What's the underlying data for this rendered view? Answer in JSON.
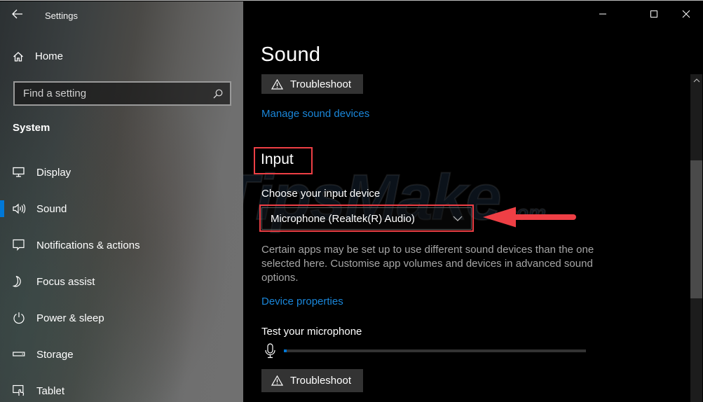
{
  "window": {
    "title": "Settings",
    "controls": {
      "minimize": "minimize-icon",
      "maximize": "maximize-icon",
      "close": "close-icon"
    }
  },
  "sidebar": {
    "back_icon": "back-arrow-icon",
    "home_label": "Home",
    "search_placeholder": "Find a setting",
    "section_title": "System",
    "items": [
      {
        "label": "Display",
        "icon": "monitor-icon",
        "active": false
      },
      {
        "label": "Sound",
        "icon": "speaker-icon",
        "active": true
      },
      {
        "label": "Notifications & actions",
        "icon": "notification-icon",
        "active": false
      },
      {
        "label": "Focus assist",
        "icon": "moon-icon",
        "active": false
      },
      {
        "label": "Power & sleep",
        "icon": "power-icon",
        "active": false
      },
      {
        "label": "Storage",
        "icon": "storage-icon",
        "active": false
      },
      {
        "label": "Tablet",
        "icon": "tablet-icon",
        "active": false
      }
    ],
    "accent_color": "#0078d7"
  },
  "main": {
    "page_title": "Sound",
    "output_troubleshoot_label": "Troubleshoot",
    "manage_devices_link": "Manage sound devices",
    "input_heading": "Input",
    "choose_device_label": "Choose your input device",
    "selected_input_device": "Microphone (Realtek(R) Audio)",
    "description": "Certain apps may be set up to use different sound devices than the one selected here. Customise app volumes and devices in advanced sound options.",
    "device_properties_link": "Device properties",
    "test_mic_label": "Test your microphone",
    "mic_level_percent": 1,
    "input_troubleshoot_label": "Troubleshoot",
    "link_color": "#1a86d9"
  },
  "annotations": {
    "highlight_color": "#ee3f45",
    "watermark": "TipsMake",
    "watermark_suffix": ".com"
  }
}
